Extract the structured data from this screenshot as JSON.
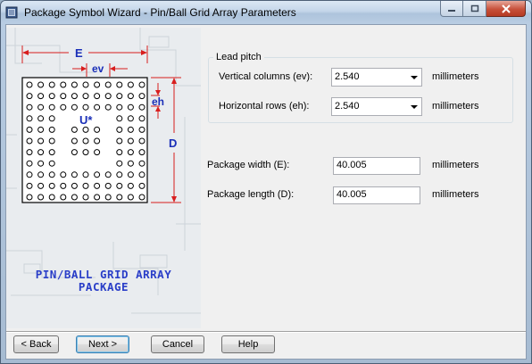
{
  "window": {
    "title": "Package Symbol Wizard - Pin/Ball Grid Array Parameters"
  },
  "diagram": {
    "dim_e": "E",
    "dim_ev": "ev",
    "dim_eh": "eh",
    "dim_d": "D",
    "ref_label": "U*",
    "caption_line1": "PIN/BALL GRID ARRAY",
    "caption_line2": "PACKAGE"
  },
  "lead_pitch": {
    "group_label": "Lead pitch",
    "vertical_label": "Vertical columns (ev):",
    "vertical_value": "2.540",
    "vertical_unit": "millimeters",
    "horizontal_label": "Horizontal rows (eh):",
    "horizontal_value": "2.540",
    "horizontal_unit": "millimeters"
  },
  "package": {
    "width_label": "Package width (E):",
    "width_value": "40.005",
    "width_unit": "millimeters",
    "length_label": "Package length (D):",
    "length_value": "40.005",
    "length_unit": "millimeters"
  },
  "buttons": {
    "back": "< Back",
    "next": "Next >",
    "cancel": "Cancel",
    "help": "Help"
  }
}
